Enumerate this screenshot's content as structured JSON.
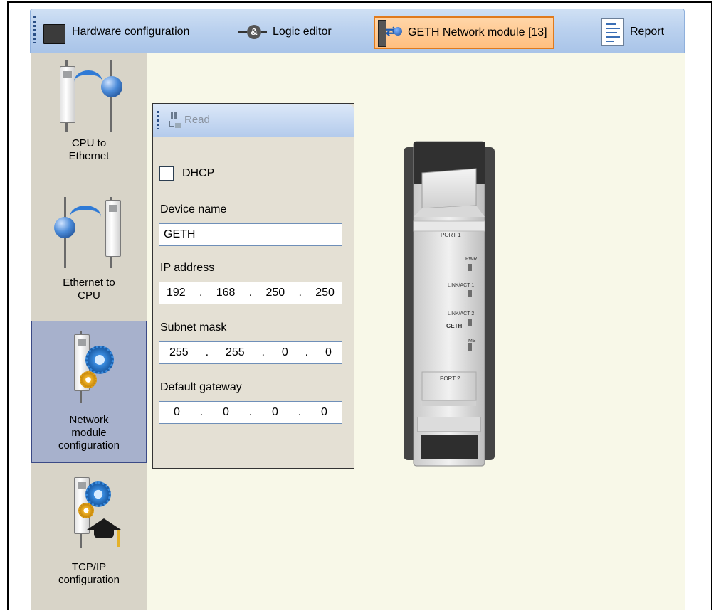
{
  "toolbar": {
    "tabs": [
      {
        "label": "Hardware configuration",
        "icon": "hardware-icon"
      },
      {
        "label": "Logic editor",
        "icon": "logic-editor-icon"
      },
      {
        "label": "GETH Network module [13]",
        "icon": "network-module-icon",
        "active": true
      },
      {
        "label": "Report",
        "icon": "report-icon"
      }
    ]
  },
  "sidebar": {
    "items": [
      {
        "label_lines": [
          "CPU to",
          "Ethernet"
        ]
      },
      {
        "label_lines": [
          "Ethernet to",
          "CPU"
        ]
      },
      {
        "label_lines": [
          "Network",
          "module",
          "configuration"
        ],
        "selected": true
      },
      {
        "label_lines": [
          "TCP/IP",
          "configuration"
        ]
      }
    ]
  },
  "panel": {
    "read_label": "Read",
    "dhcp_label": "DHCP",
    "dhcp_checked": false,
    "device_name_label": "Device name",
    "device_name_value": "GETH",
    "ip_label": "IP address",
    "ip": [
      "192",
      "168",
      "250",
      "250"
    ],
    "subnet_label": "Subnet mask",
    "subnet": [
      "255",
      "255",
      "0",
      "0"
    ],
    "gateway_label": "Default gateway",
    "gateway": [
      "0",
      "0",
      "0",
      "0"
    ],
    "dot": "."
  },
  "device": {
    "port1": "PORT 1",
    "pwr": "PWR",
    "link1": "LINK/ACT 1",
    "link2": "LINK/ACT 2",
    "geth": "GETH",
    "ms": "MS",
    "port2": "PORT 2"
  },
  "colors": {
    "toolbar": "#b9d0ee",
    "active_tab": "#ffbf80",
    "sidebar": "#d8d4c8",
    "selected_item": "#a7b1cc",
    "main_bg": "#f8f8e8"
  }
}
